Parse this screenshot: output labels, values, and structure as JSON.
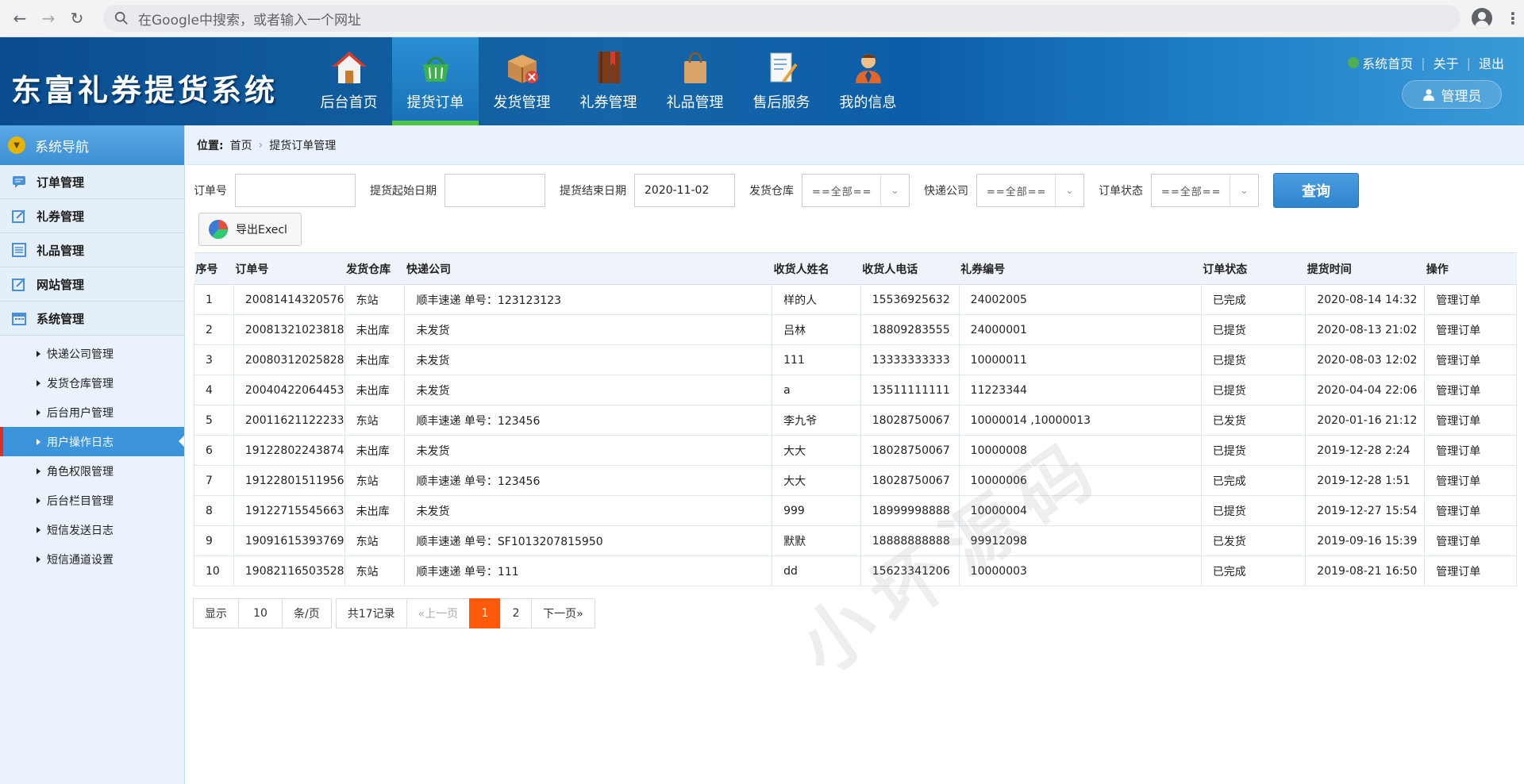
{
  "browser": {
    "omnibox_placeholder": "在Google中搜索，或者输入一个网址"
  },
  "header": {
    "logo": "东富礼券提货系统",
    "menu": [
      {
        "label": "后台首页",
        "icon": "house-icon"
      },
      {
        "label": "提货订单",
        "icon": "basket-icon",
        "active": true
      },
      {
        "label": "发货管理",
        "icon": "package-icon"
      },
      {
        "label": "礼券管理",
        "icon": "book-icon"
      },
      {
        "label": "礼品管理",
        "icon": "shopping-bag-icon"
      },
      {
        "label": "售后服务",
        "icon": "document-pencil-icon"
      },
      {
        "label": "我的信息",
        "icon": "person-icon"
      }
    ],
    "links": {
      "home": "系统首页",
      "about": "关于",
      "logout": "退出"
    },
    "admin": "管理员"
  },
  "sidebar": {
    "title": "系统导航",
    "sections": [
      {
        "label": "订单管理",
        "icon": "chat-icon"
      },
      {
        "label": "礼券管理",
        "icon": "edit-icon"
      },
      {
        "label": "礼品管理",
        "icon": "list-icon"
      },
      {
        "label": "网站管理",
        "icon": "edit-icon"
      },
      {
        "label": "系统管理",
        "icon": "calendar-icon"
      }
    ],
    "sub_items": [
      "快递公司管理",
      "发货仓库管理",
      "后台用户管理",
      "用户操作日志",
      "角色权限管理",
      "后台栏目管理",
      "短信发送日志",
      "短信通道设置"
    ],
    "active_sub_index": 3
  },
  "breadcrumb": {
    "prefix": "位置:",
    "home": "首页",
    "current": "提货订单管理"
  },
  "filters": {
    "order_no_label": "订单号",
    "order_no_value": "",
    "start_date_label": "提货起始日期",
    "start_date_value": "",
    "end_date_label": "提货结束日期",
    "end_date_value": "2020-11-02",
    "warehouse_label": "发货仓库",
    "warehouse_value": "==全部==",
    "courier_label": "快递公司",
    "courier_value": "==全部==",
    "status_label": "订单状态",
    "status_value": "==全部==",
    "query_button": "查询",
    "export_button": "导出Execl"
  },
  "table": {
    "headers": [
      "序号",
      "订单号",
      "发货仓库",
      "快递公司",
      "收货人姓名",
      "收货人电话",
      "礼券编号",
      "订单状态",
      "提货时间",
      "操作"
    ],
    "rows": [
      {
        "no": "1",
        "order": "20081414320576",
        "warehouse": "东站",
        "wh_red": false,
        "courier": "顺丰速递 单号：123123123",
        "c_red": false,
        "name": "样的人",
        "phone": "15536925632",
        "coupon": "24002005",
        "status": "已完成",
        "status_color": "green",
        "time": "2020-08-14 14:32",
        "op": "管理订单"
      },
      {
        "no": "2",
        "order": "20081321023818",
        "warehouse": "未出库",
        "wh_red": true,
        "courier": "未发货",
        "c_red": true,
        "name": "吕林",
        "phone": "18809283555",
        "coupon": "24000001",
        "status": "已提货",
        "status_color": "",
        "time": "2020-08-13 21:02",
        "op": "管理订单"
      },
      {
        "no": "3",
        "order": "20080312025828",
        "warehouse": "未出库",
        "wh_red": true,
        "courier": "未发货",
        "c_red": true,
        "name": "111",
        "phone": "13333333333",
        "coupon": "10000011",
        "status": "已提货",
        "status_color": "",
        "time": "2020-08-03 12:02",
        "op": "管理订单"
      },
      {
        "no": "4",
        "order": "20040422064453",
        "warehouse": "未出库",
        "wh_red": true,
        "courier": "未发货",
        "c_red": true,
        "name": "a",
        "phone": "13511111111",
        "coupon": "11223344",
        "status": "已提货",
        "status_color": "",
        "time": "2020-04-04 22:06",
        "op": "管理订单"
      },
      {
        "no": "5",
        "order": "20011621122233",
        "warehouse": "东站",
        "wh_red": false,
        "courier": "顺丰速递 单号：123456",
        "c_red": false,
        "name": "李九爷",
        "phone": "18028750067",
        "coupon": "10000014 ,10000013",
        "status": "已发货",
        "status_color": "blue",
        "time": "2020-01-16 21:12",
        "op": "管理订单"
      },
      {
        "no": "6",
        "order": "19122802243874",
        "warehouse": "未出库",
        "wh_red": true,
        "courier": "未发货",
        "c_red": true,
        "name": "大大",
        "phone": "18028750067",
        "coupon": "10000008",
        "status": "已提货",
        "status_color": "",
        "time": "2019-12-28 2:24",
        "op": "管理订单"
      },
      {
        "no": "7",
        "order": "19122801511956",
        "warehouse": "东站",
        "wh_red": false,
        "courier": "顺丰速递 单号：123456",
        "c_red": false,
        "name": "大大",
        "phone": "18028750067",
        "coupon": "10000006",
        "status": "已完成",
        "status_color": "green",
        "time": "2019-12-28 1:51",
        "op": "管理订单"
      },
      {
        "no": "8",
        "order": "19122715545663",
        "warehouse": "未出库",
        "wh_red": true,
        "courier": "未发货",
        "c_red": true,
        "name": "999",
        "phone": "18999998888",
        "coupon": "10000004",
        "status": "已提货",
        "status_color": "",
        "time": "2019-12-27 15:54",
        "op": "管理订单"
      },
      {
        "no": "9",
        "order": "19091615393769",
        "warehouse": "东站",
        "wh_red": false,
        "courier": "顺丰速递 单号：SF1013207815950",
        "c_red": false,
        "name": "默默",
        "phone": "18888888888",
        "coupon": "99912098",
        "status": "已发货",
        "status_color": "blue",
        "time": "2019-09-16 15:39",
        "op": "管理订单"
      },
      {
        "no": "10",
        "order": "19082116503528",
        "warehouse": "东站",
        "wh_red": false,
        "courier": "顺丰速递 单号：111",
        "c_red": false,
        "name": "dd",
        "phone": "15623341206",
        "coupon": "10000003",
        "status": "已完成",
        "status_color": "green",
        "time": "2019-08-21 16:50",
        "op": "管理订单"
      }
    ]
  },
  "pager": {
    "show": "显示",
    "per_page": "10",
    "per_page_unit": "条/页",
    "total": "共17记录",
    "prev": "«上一页",
    "pages": [
      "1",
      "2"
    ],
    "current": "1",
    "next": "下一页»"
  },
  "watermark": "小坏源码",
  "colors": {
    "accent": "#3c95db",
    "header": "#0c5ea8",
    "status_done": "#2e9a2e",
    "status_shipped": "#2b53a8",
    "warning": "#c0392b",
    "action": "#e67e22",
    "pager_current": "#ff5a0a"
  }
}
